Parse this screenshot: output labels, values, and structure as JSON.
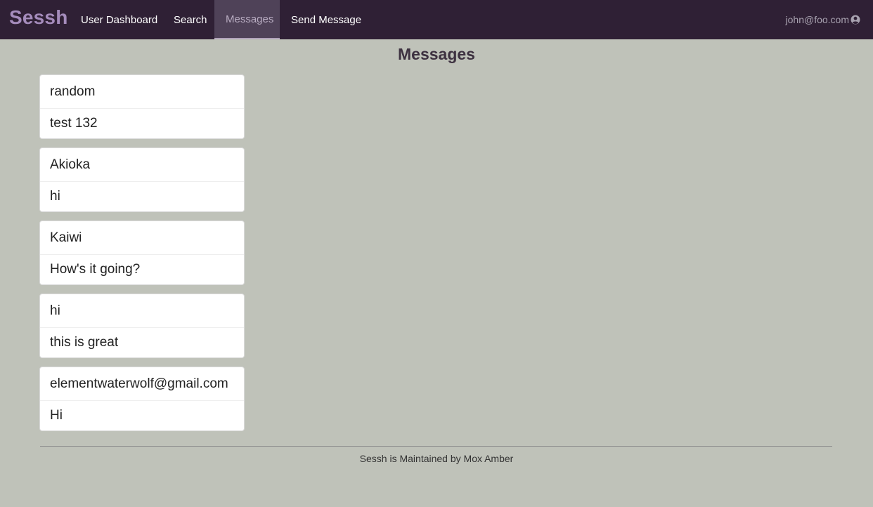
{
  "navbar": {
    "brand": "Sessh",
    "items": [
      {
        "label": "User Dashboard",
        "active": false
      },
      {
        "label": "Search",
        "active": false
      },
      {
        "label": "Messages",
        "active": true
      },
      {
        "label": "Send Message",
        "active": false
      }
    ],
    "user": "john@foo.com",
    "user_icon": "user-circle-icon"
  },
  "page": {
    "title": "Messages"
  },
  "messages": [
    {
      "sender": "random",
      "body": "test 132"
    },
    {
      "sender": "Akioka",
      "body": "hi"
    },
    {
      "sender": "Kaiwi",
      "body": "How's it going?"
    },
    {
      "sender": "hi",
      "body": "this is great"
    },
    {
      "sender": "elementwaterwolf@gmail.com",
      "body": "Hi"
    }
  ],
  "footer": {
    "text": "Sessh is Maintained by Mox Amber"
  },
  "colors": {
    "navbar_bg": "#2f2035",
    "brand": "#a58cbc",
    "active_tab_bg": "#4f4258",
    "page_bg": "#bfc2b9",
    "title": "#3d3140"
  }
}
